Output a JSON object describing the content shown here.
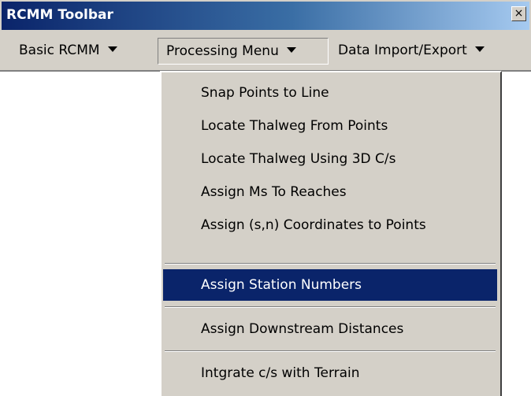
{
  "window": {
    "title": "RCMM Toolbar",
    "close_glyph": "×",
    "title_colors": [
      "#0a246a",
      "#a6caf0"
    ]
  },
  "menubar": {
    "items": [
      {
        "label": "Basic RCMM"
      },
      {
        "label": "Processing Menu",
        "open": true
      },
      {
        "label": "Data Import/Export"
      }
    ]
  },
  "dropdown": {
    "items": [
      {
        "label": "Snap Points to Line"
      },
      {
        "label": "Locate Thalweg From Points"
      },
      {
        "label": "Locate Thalweg Using 3D C/s"
      },
      {
        "label": "Assign Ms To Reaches"
      },
      {
        "label": "Assign (s,n) Coordinates to Points"
      },
      {
        "label": "Assign Station Numbers",
        "selected": true
      },
      {
        "label": "Assign Downstream Distances"
      },
      {
        "label": "Intgrate c/s with Terrain"
      }
    ],
    "highlight_color": "#0a246a"
  }
}
